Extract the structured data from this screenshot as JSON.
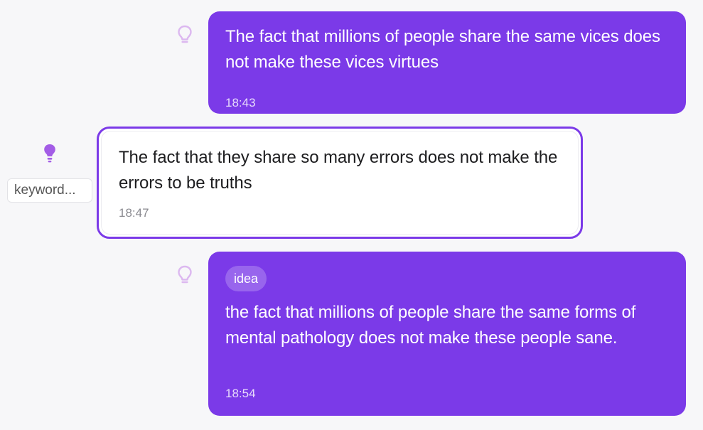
{
  "messages": [
    {
      "direction": "sent",
      "text": "The fact that millions of people share the same vices does not make these vices virtues",
      "time": "18:43",
      "bulb_icon": "lightbulb-outline-icon"
    },
    {
      "direction": "received",
      "text": "The fact that they share so many errors does not make the errors to be truths",
      "time": "18:47",
      "bulb_icon": "lightbulb-filled-icon",
      "keyword": "keyword..."
    },
    {
      "direction": "sent",
      "tag": "idea",
      "text": "the fact that millions of people share the same forms of mental pathology does not make these people sane.",
      "time": "18:54",
      "bulb_icon": "lightbulb-outline-icon"
    }
  ],
  "colors": {
    "sent_bubble": "#7b3ae8",
    "received_border": "#7b3ae8",
    "bulb_outline": "#dcb8f0",
    "bulb_filled": "#a35ce6",
    "background": "#f7f7f9"
  }
}
